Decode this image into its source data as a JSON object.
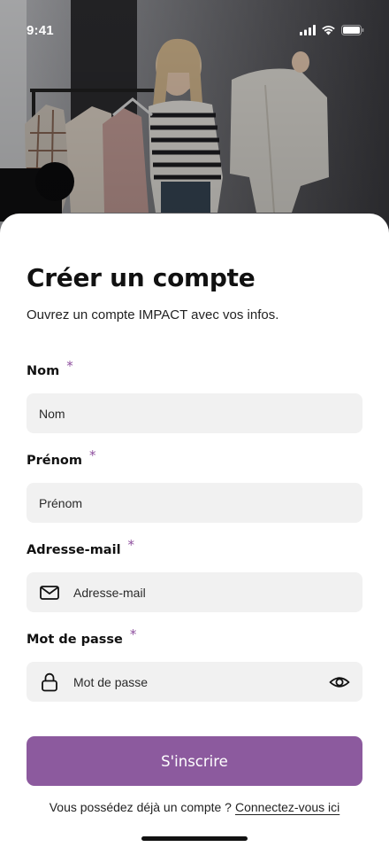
{
  "status_bar": {
    "time": "9:41"
  },
  "hero": {
    "image": "woman-showing-clothes-photo"
  },
  "header": {
    "title": "Créer un compte",
    "subtitle": "Ouvrez un compte IMPACT avec vos infos."
  },
  "form": {
    "required_mark": "*",
    "nom": {
      "label": "Nom",
      "placeholder": "Nom"
    },
    "prenom": {
      "label": "Prénom",
      "placeholder": "Prénom"
    },
    "email": {
      "label": "Adresse-mail",
      "placeholder": "Adresse-mail",
      "icon": "mail-icon"
    },
    "password": {
      "label": "Mot de passe",
      "placeholder": "Mot de passe",
      "icon": "lock-icon",
      "toggle_icon": "eye-icon"
    }
  },
  "submit": {
    "label": "S'inscrire"
  },
  "footer": {
    "question": "Vous possédez déjà un compte ?",
    "link": "Connectez-vous ici"
  },
  "colors": {
    "accent": "#8c5a9e",
    "required_star": "#8e4f9e",
    "field_background": "#f1f1f1"
  }
}
